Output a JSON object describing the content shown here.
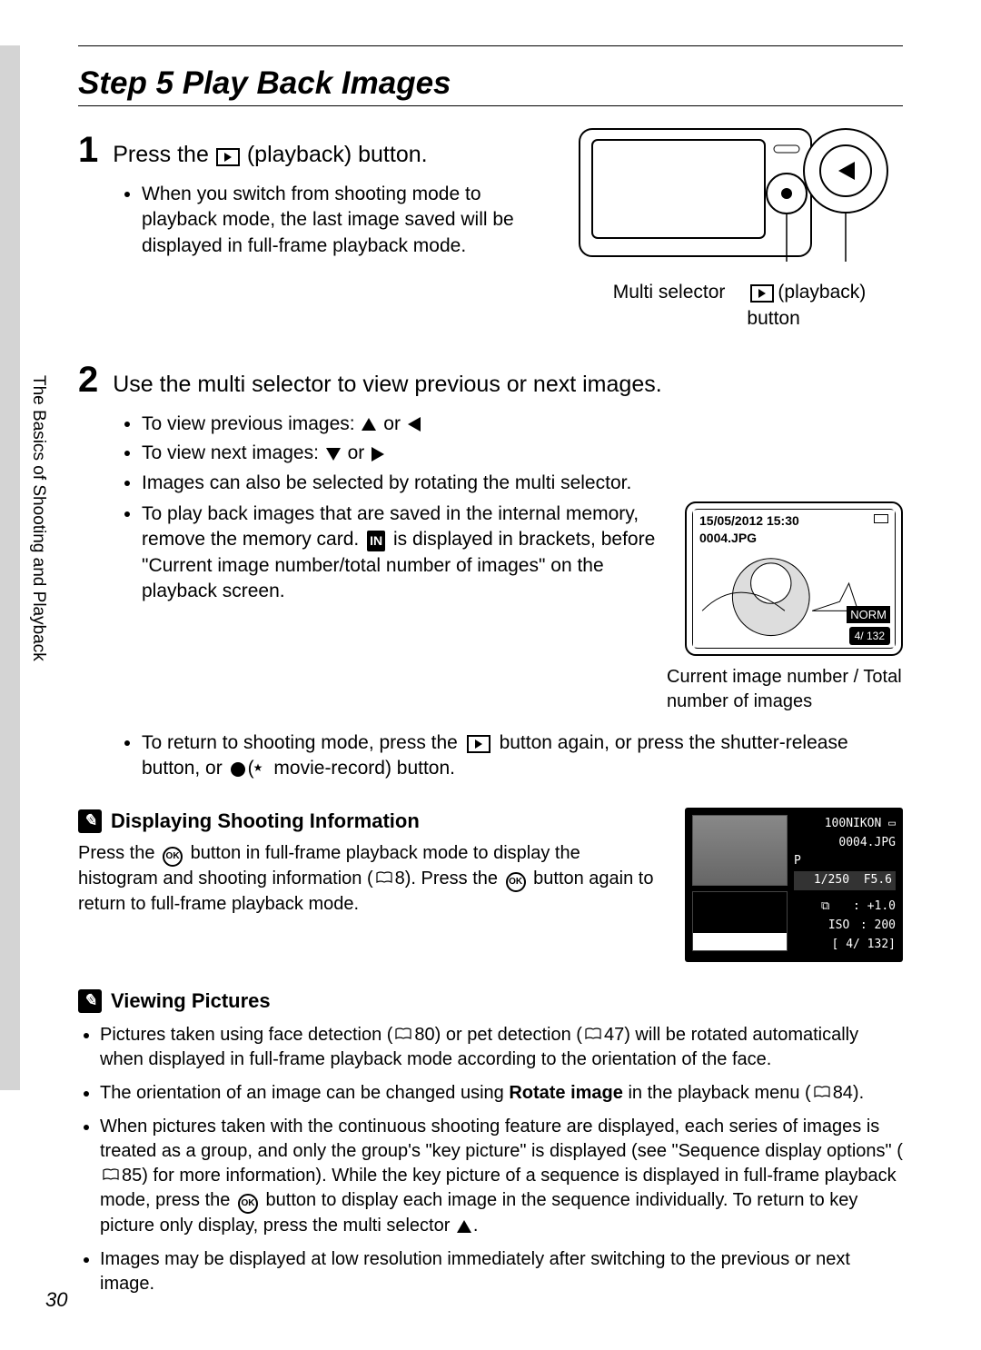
{
  "title": "Step 5 Play Back Images",
  "sideTab": "The Basics of Shooting and Playback",
  "pageNumber": "30",
  "step1": {
    "num": "1",
    "heading_pre": "Press the",
    "heading_post": "(playback) button.",
    "bullet": "When you switch from shooting mode to playback mode, the last image saved will be displayed in full-frame playback mode.",
    "label_multiselector": "Multi selector",
    "label_playback_pre": "(playback)",
    "label_playback_post": "button"
  },
  "step2": {
    "num": "2",
    "heading": "Use the multi selector to view previous or next images.",
    "b1_pre": "To view previous images:",
    "b1_or": "or",
    "b2_pre": "To view next images:",
    "b2_or": "or",
    "b3": "Images can also be selected by rotating the multi selector.",
    "b4_a": "To play back images that are saved in the internal memory, remove the memory card.",
    "b4_b": "is displayed in brackets, before \"Current image number/total number of images\" on the playback screen.",
    "preview_date": "15/05/2012 15:30",
    "preview_file": "0004.JPG",
    "preview_norm": "NORM",
    "preview_count": "4/ 132",
    "caption": "Current image number / Total number of images",
    "b5_a": "To return to shooting mode, press the",
    "b5_b": "button again, or press the shutter-release button, or",
    "b5_c": "movie-record) button."
  },
  "note1": {
    "title": "Displaying Shooting Information",
    "body_a": "Press the",
    "body_b": "button in full-frame playback mode to display the histogram and shooting information (",
    "body_ref": "8). Press the",
    "body_c": "button again to return to full-frame playback mode.",
    "hist_folder": "100NIKON",
    "hist_file": "0004.JPG",
    "hist_mode": "P",
    "hist_shutter": "1/250",
    "hist_f": "F5.6",
    "hist_exp_lab": "",
    "hist_exp": "+1.0",
    "hist_iso_lab": "ISO",
    "hist_iso": "200",
    "hist_count": "[      4/  132]"
  },
  "note2": {
    "title": "Viewing Pictures",
    "li1_a": "Pictures taken using face detection (",
    "li1_ref1": "80) or pet detection (",
    "li1_ref2": "47) will be rotated automatically when displayed in full-frame playback mode according to the orientation of the face.",
    "li2_a": "The orientation of an image can be changed using ",
    "li2_bold": "Rotate image",
    "li2_b": " in the playback menu (",
    "li2_ref": "84).",
    "li3_a": "When pictures taken with the continuous shooting feature are displayed, each series of images is treated as a group, and only the group's \"key picture\" is displayed (see \"Sequence display options\" (",
    "li3_ref": "85) for more information). While the key picture of a sequence is displayed in full-frame playback mode, press the",
    "li3_b": "button to display each image in the sequence individually. To return to key picture only display, press the multi selector",
    "li3_c": ".",
    "li4": "Images may be displayed at low resolution immediately after switching to the previous or next image."
  }
}
